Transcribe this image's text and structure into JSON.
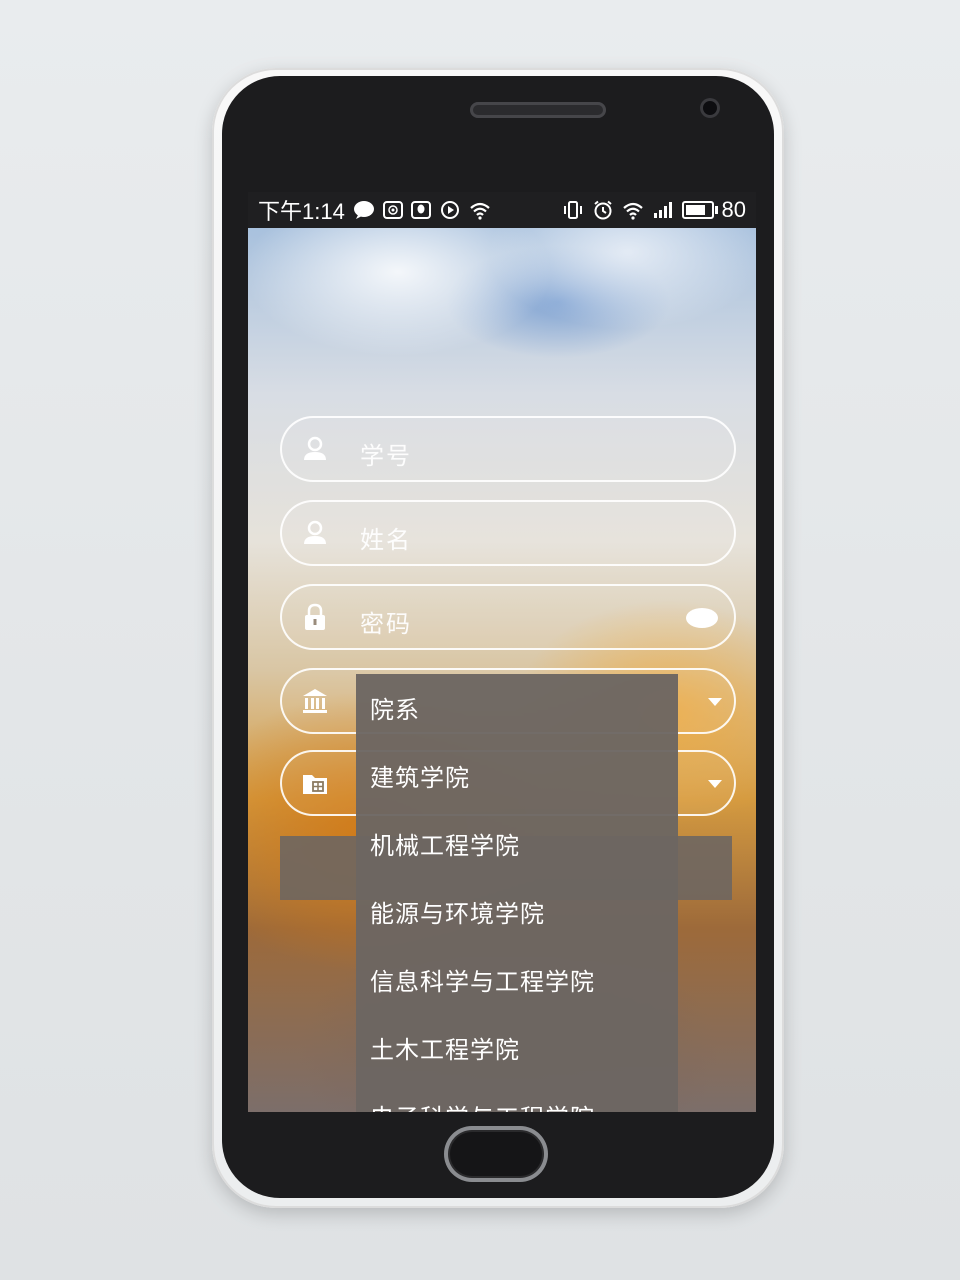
{
  "status_bar": {
    "time": "下午1:14",
    "battery": "80",
    "battery_level_pct": 80,
    "left_icons": [
      "chat-bubble-icon",
      "weibo-icon",
      "qq-icon",
      "play-icon",
      "wifi-icon"
    ],
    "right_icons": [
      "vibrate-icon",
      "alarm-icon",
      "wifi-icon",
      "4g-signal-icon",
      "battery-icon"
    ]
  },
  "form": {
    "student_id": {
      "placeholder": "学号",
      "icon": "user-icon"
    },
    "name": {
      "placeholder": "姓名",
      "icon": "user-icon"
    },
    "password": {
      "placeholder": "密码",
      "icon": "lock-icon",
      "toggle_icon": "eye-icon"
    },
    "department": {
      "icon": "building-icon"
    },
    "major": {
      "icon": "folder-icon"
    }
  },
  "dropdown": {
    "items": [
      "院系",
      "建筑学院",
      "机械工程学院",
      "能源与环境学院",
      "信息科学与工程学院",
      "土木工程学院",
      "电子科学与工程学院"
    ]
  }
}
